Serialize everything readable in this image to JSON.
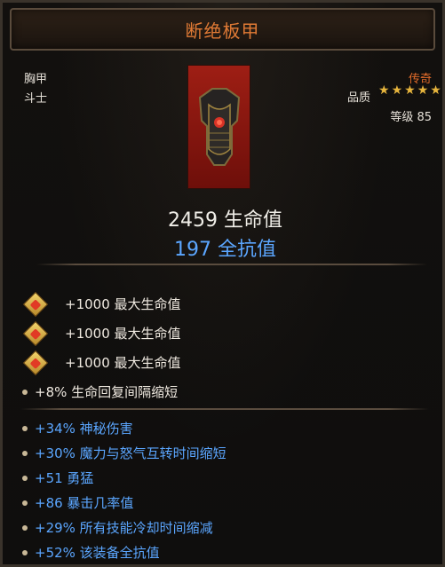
{
  "item": {
    "name": "断绝板甲",
    "slot": "胸甲",
    "class": "斗士",
    "rarity": "传奇",
    "quality_label": "品质",
    "quality_stars": 5,
    "level_text": "等级 85"
  },
  "stats": {
    "life": "2459 生命值",
    "resist": "197 全抗值"
  },
  "gems": [
    {
      "text": "+1000 最大生命值",
      "icon": "ruby-gem-icon"
    },
    {
      "text": "+1000 最大生命值",
      "icon": "ruby-gem-icon"
    },
    {
      "text": "+1000 最大生命值",
      "icon": "ruby-gem-icon"
    }
  ],
  "implicit": [
    "+8% 生命回复间隔缩短"
  ],
  "affixes": [
    "+34% 神秘伤害",
    "+30% 魔力与怒气互转时间缩短",
    "+51 勇猛",
    "+86 暴击几率值",
    "+29% 所有技能冷却时间缩减",
    "+52% 该装备全抗值"
  ],
  "colors": {
    "title": "#e07a35",
    "rarity": "#e36c2a",
    "affix_blue": "#5ba6ff",
    "star_gold": "#e7b53d",
    "icon_red": "#9e1e14"
  }
}
